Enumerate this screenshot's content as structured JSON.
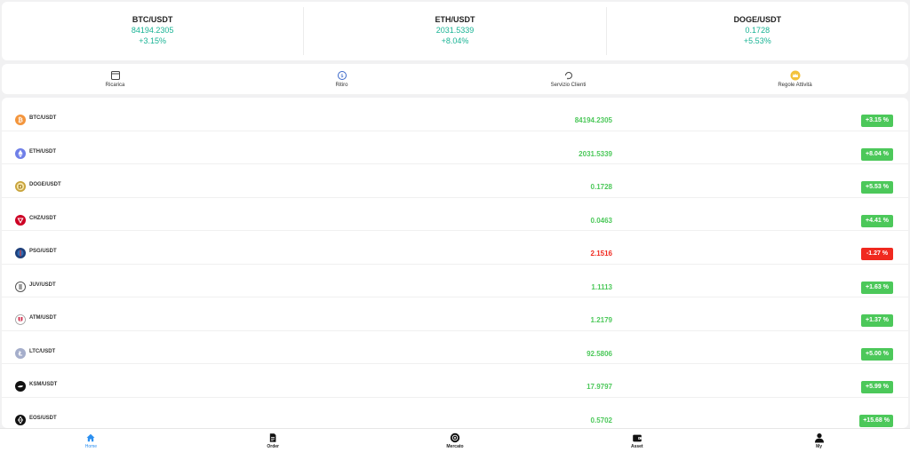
{
  "tickers": [
    {
      "symbol": "BTC/USDT",
      "price": "84194.2305",
      "change": "+3.15%"
    },
    {
      "symbol": "ETH/USDT",
      "price": "2031.5339",
      "change": "+8.04%"
    },
    {
      "symbol": "DOGE/USDT",
      "price": "0.1728",
      "change": "+5.53%"
    }
  ],
  "actions": [
    {
      "label": "Ricarica",
      "icon": "wallet-card-icon"
    },
    {
      "label": "Ritiro",
      "icon": "coin-withdraw-icon"
    },
    {
      "label": "Servizio Clienti",
      "icon": "support-headset-icon"
    },
    {
      "label": "Regole Attività",
      "icon": "crown-badge-icon"
    }
  ],
  "markets": [
    {
      "pair": "BTC/USDT",
      "price": "84194.2305",
      "change": "+3.15 %",
      "up": true
    },
    {
      "pair": "ETH/USDT",
      "price": "2031.5339",
      "change": "+8.04 %",
      "up": true
    },
    {
      "pair": "DOGE/USDT",
      "price": "0.1728",
      "change": "+5.53 %",
      "up": true
    },
    {
      "pair": "CHZ/USDT",
      "price": "0.0463",
      "change": "+4.41 %",
      "up": true
    },
    {
      "pair": "PSG/USDT",
      "price": "2.1516",
      "change": "-1.27 %",
      "up": false
    },
    {
      "pair": "JUV/USDT",
      "price": "1.1113",
      "change": "+1.63 %",
      "up": true
    },
    {
      "pair": "ATM/USDT",
      "price": "1.2179",
      "change": "+1.37 %",
      "up": true
    },
    {
      "pair": "LTC/USDT",
      "price": "92.5806",
      "change": "+5.00 %",
      "up": true
    },
    {
      "pair": "KSM/USDT",
      "price": "17.9797",
      "change": "+5.99 %",
      "up": true
    },
    {
      "pair": "EOS/USDT",
      "price": "0.5702",
      "change": "+15.68 %",
      "up": true
    }
  ],
  "tabs": [
    {
      "label": "Home",
      "icon": "home-icon",
      "active": true
    },
    {
      "label": "Order",
      "icon": "document-icon",
      "active": false
    },
    {
      "label": "Mercato",
      "icon": "market-coin-icon",
      "active": false
    },
    {
      "label": "Asset",
      "icon": "wallet-icon",
      "active": false
    },
    {
      "label": "My",
      "icon": "user-icon",
      "active": false
    }
  ],
  "colors": {
    "up": "#4cc85a",
    "down": "#f0291f",
    "ticker_green": "#18b394",
    "active_tab": "#2b8ff0",
    "btc": "#f3953c",
    "eth": "#6f7fe8",
    "doge": "#c8a33a",
    "chz": "#cd0124",
    "psg": "#1d3f7a",
    "juv": "#555555",
    "atm": "#cf2a4a",
    "ltc": "#a5aecb",
    "ksm": "#111111",
    "eos": "#111111"
  }
}
